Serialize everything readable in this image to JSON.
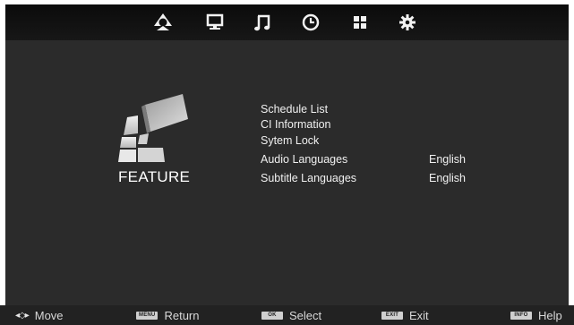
{
  "top_tabs": [
    {
      "name": "channel",
      "icon": "satellite-dish-icon"
    },
    {
      "name": "picture",
      "icon": "monitor-icon"
    },
    {
      "name": "sound",
      "icon": "music-note-icon"
    },
    {
      "name": "time",
      "icon": "clock-icon"
    },
    {
      "name": "feature",
      "icon": "grid-icon"
    },
    {
      "name": "setup",
      "icon": "gear-icon"
    }
  ],
  "section": {
    "title": "FEATURE",
    "icon": "feature-blocks-icon"
  },
  "menu": {
    "items": [
      {
        "label": "Schedule List",
        "value": ""
      },
      {
        "label": "CI Information",
        "value": ""
      },
      {
        "label": "Sytem Lock",
        "value": ""
      },
      {
        "label": "Audio Languages",
        "value": "English"
      },
      {
        "label": "Subtitle Languages",
        "value": "English"
      }
    ]
  },
  "hints": [
    {
      "key": "",
      "label": "Move"
    },
    {
      "key": "MENU",
      "label": "Return"
    },
    {
      "key": "OK",
      "label": "Select"
    },
    {
      "key": "EXIT",
      "label": "Exit"
    },
    {
      "key": "INFO",
      "label": "Help"
    }
  ],
  "colors": {
    "background": "#2b2b2b",
    "topbar": "#111111",
    "text": "#f0f0f0"
  }
}
